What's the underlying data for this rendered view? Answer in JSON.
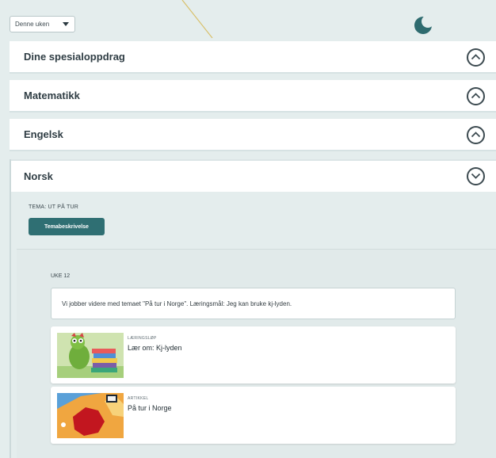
{
  "header": {
    "week_filter": {
      "selected": "Denne uken"
    },
    "theme_icon": "moon-icon"
  },
  "subjects": [
    {
      "label": "Dine spesialoppdrag",
      "state": "collapsed"
    },
    {
      "label": "Matematikk",
      "state": "collapsed"
    },
    {
      "label": "Engelsk",
      "state": "collapsed"
    }
  ],
  "norsk": {
    "label": "Norsk",
    "state": "expanded",
    "tema_label": "TEMA: UT PÅ TUR",
    "tema_button": "Temabeskrivelse",
    "week": {
      "label": "UKE 12",
      "note": "Vi jobber videre med temaet \"På tur i Norge\". Læringsmål: Jeg kan bruke kj-lyden.",
      "items": [
        {
          "kind": "LÆRINGSLØP",
          "title": "Lær om: Kj-lyden",
          "thumb": "dragon-books-illustration"
        },
        {
          "kind": "ARTIKKEL",
          "title": "På tur i Norge",
          "thumb": "norway-map-illustration"
        }
      ]
    }
  },
  "colors": {
    "background": "#e4eded",
    "accent": "#2f6f73",
    "moon": "#2e6b6f"
  }
}
